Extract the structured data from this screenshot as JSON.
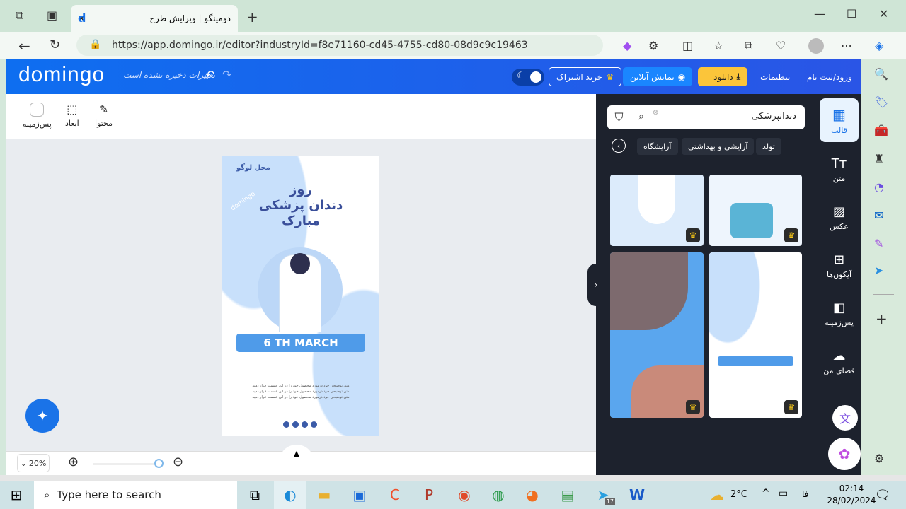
{
  "browser": {
    "tab_title": "دومینگو | ویرایش طرح",
    "url": "https://app.domingo.ir/editor?industryId=f8e71160-cd45-4755-cd80-08d9c9c19463"
  },
  "header": {
    "logo": "domingo",
    "unsaved": "تغییرات ذخیره نشده است",
    "login": "ورود/ثبت نام",
    "settings": "تنظیمات",
    "download": "دانلود",
    "preview": "نمایش آنلاین",
    "subscribe": "خرید اشتراک",
    "colors": {
      "accent": "#0e6ef0",
      "download": "#fbc53a"
    }
  },
  "toolbar": {
    "content": "محتوا",
    "dimensions": "ابعاد",
    "background": "پس‌زمینه"
  },
  "poster": {
    "brand": "محل لوگو",
    "title1": "روز",
    "title2": "دندان پزشکی",
    "title3": "مبارک",
    "banner": "6 TH MARCH",
    "body": "متن توضیحی خود درمورد محصول خود را در این قسمت قرار دهید متن توضیحی خود درمورد محصول خود را در این قسمت قرار دهید متن توضیحی خود درمورد محصول خود را در این قسمت قرار دهید",
    "watermark": "domingo"
  },
  "zoom": {
    "level": "20%",
    "progress": 0.2
  },
  "panel": {
    "search_value": "دندانپزشکی",
    "chips": [
      "تولد",
      "آرایشی و بهداشتی",
      "آرایشگاه"
    ]
  },
  "nav": {
    "items": [
      "قالب",
      "متن",
      "عکس",
      "آیکون‌ها",
      "پس‌زمینه",
      "فضای من"
    ]
  },
  "taskbar": {
    "search_placeholder": "Type here to search",
    "weather": "2°C",
    "lang": "فا",
    "time": "02:14",
    "date": "28/02/2024",
    "telegram_badge": "17"
  }
}
